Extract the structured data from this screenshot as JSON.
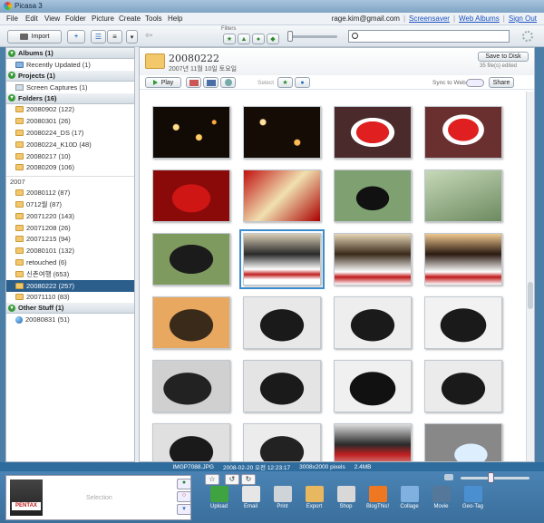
{
  "window": {
    "title": "Picasa 3"
  },
  "menu": {
    "items": [
      "File",
      "Edit",
      "View",
      "Folder",
      "Picture",
      "Create",
      "Tools",
      "Help"
    ],
    "email": "rage.kim@gmail.com",
    "screensaver": "Screensaver",
    "web_albums": "Web Albums",
    "sign_out": "Sign Out",
    "separator": "|"
  },
  "toolbar": {
    "import_label": "Import",
    "filters_label": "Filters",
    "search_value": ""
  },
  "sidebar": {
    "sections": [
      {
        "title": "Albums (1)",
        "items": [
          {
            "label": "Recently Updated (1)",
            "icon": "album-icon"
          }
        ]
      },
      {
        "title": "Projects (1)",
        "items": [
          {
            "label": "Screen Captures (1)",
            "icon": "screen-icon"
          }
        ]
      },
      {
        "title": "Folders (16)",
        "items": [
          {
            "label": "20080902 (122)"
          },
          {
            "label": "20080301 (26)"
          },
          {
            "label": "20080224_DS (17)"
          },
          {
            "label": "20080224_K10D (48)"
          },
          {
            "label": "20080217 (10)"
          },
          {
            "label": "20080209 (106)"
          }
        ]
      }
    ],
    "year": "2007",
    "year_items": [
      {
        "label": "20080112 (87)"
      },
      {
        "label": "0712월 (87)"
      },
      {
        "label": "20071220 (143)"
      },
      {
        "label": "20071208 (26)"
      },
      {
        "label": "20071215 (94)"
      },
      {
        "label": "20080101 (132)"
      },
      {
        "label": "retouched (6)"
      },
      {
        "label": "신촌여행 (653)"
      },
      {
        "label": "20080222 (257)",
        "selected": true
      },
      {
        "label": "20071110 (83)"
      }
    ],
    "other": {
      "title": "Other Stuff (1)",
      "items": [
        {
          "label": "20080831 (51)"
        }
      ]
    }
  },
  "folder": {
    "name": "20080222",
    "date": "2007년 11월 10일 토요일",
    "save_to_disk": "Save to Disk",
    "files_edited": "35 file(s) edited",
    "play": "Play",
    "select": "Select",
    "sync": "Sync to Web",
    "share": "Share"
  },
  "thumbnails": [
    {
      "bg": "radial-gradient(circle at 30% 40%,#ffdd88 0 3px,transparent 4px),radial-gradient(circle at 60% 60%,#ffcc66 0 3px,transparent 4px),radial-gradient(circle at 80% 30%,#ffaa44 0 2px,transparent 3px),#120a04"
    },
    {
      "bg": "radial-gradient(circle at 25% 30%,#ffe0a0 0 3px,transparent 4px),radial-gradient(circle at 70% 70%,#ffbb55 0 3px,transparent 4px),#150c05"
    },
    {
      "bg": "radial-gradient(ellipse at 50% 50%,#e02020 0 30%,#fff 31% 40%,#4a2a2a 41%)"
    },
    {
      "bg": "radial-gradient(ellipse at 50% 45%,#e02020 0 28%,#fff 29% 38%,#6a3030 39%)"
    },
    {
      "bg": "radial-gradient(ellipse at 50% 55%,#d01515 0 35%,#8a0a0a 36%)"
    },
    {
      "bg": "linear-gradient(135deg,#c01010,#f0e0b0 50%,#a00)"
    },
    {
      "bg": "radial-gradient(ellipse at 50% 55%,#111 0 30%,#7fa070 31%)"
    },
    {
      "bg": "linear-gradient(160deg,#c6d8b8,#6d8a60)"
    },
    {
      "bg": "radial-gradient(ellipse at 50% 50%,#1b1b1b 0 40%,#7f9a5f 41%)"
    },
    {
      "bg": "linear-gradient(#d8ccb5,#2a2a2a 40%,#fff 70%,#c02020 80%,#fff 90%)"
    },
    {
      "bg": "linear-gradient(#e6d5b5,#3a2a1a 40%,#fff 75%,#c01818 85%,#fff)"
    },
    {
      "bg": "linear-gradient(#f0c890,#2a1a10 40%,#fff 75%,#c01818 85%,#fff)"
    },
    {
      "bg": "radial-gradient(ellipse at 50% 55%,#3a2a1a 0 40%,#e8a860 41%)"
    },
    {
      "bg": "radial-gradient(ellipse at 50% 55%,#1a1a1a 0 40%,#e8e8e8 41%)"
    },
    {
      "bg": "radial-gradient(ellipse at 50% 55%,#1a1a1a 0 40%,#eeeeee 41%)"
    },
    {
      "bg": "radial-gradient(ellipse at 50% 55%,#1a1a1a 0 42%,#f2f2f2 43%)"
    },
    {
      "bg": "radial-gradient(ellipse at 45% 55%,#222 0 40%,#d0d0d0 41%)"
    },
    {
      "bg": "radial-gradient(ellipse at 50% 55%,#1a1a1a 0 40%,#e4e4e4 41%)"
    },
    {
      "bg": "radial-gradient(ellipse at 50% 55%,#111 0 42%,#f0f0f0 43%)"
    },
    {
      "bg": "radial-gradient(ellipse at 50% 55%,#1a1a1a 0 40%,#ebebeb 41%)"
    },
    {
      "bg": "radial-gradient(ellipse at 50% 55%,#1a1a1a 0 40%,#e0e0e0 41%)"
    },
    {
      "bg": "radial-gradient(ellipse at 50% 55%,#222 0 40%,#ececec 41%)"
    },
    {
      "bg": "linear-gradient(#ddd,#2a2a2a 40%,#c02020 60%,#eee)"
    },
    {
      "bg": "radial-gradient(ellipse at 60% 60%,#ddeeff 0 25%,#888 26%)"
    }
  ],
  "status": {
    "file": "IMGP7088.JPG",
    "datetime": "2008-02-20 오전 12:23:17",
    "dims": "3008x2000 pixels",
    "size": "2.4MB"
  },
  "tray": {
    "selection_label": "Selection",
    "thumb_label": "PENTAX",
    "actions": [
      {
        "label": "Upload",
        "color": "#3fa33f"
      },
      {
        "label": "Email",
        "color": "#e6e6e6"
      },
      {
        "label": "Print",
        "color": "#cfd4d9"
      },
      {
        "label": "Export",
        "color": "#e8b860"
      },
      {
        "label": "Shop",
        "color": "#d8d8d8"
      },
      {
        "label": "BlogThis!",
        "color": "#ee7722"
      },
      {
        "label": "Collage",
        "color": "#7fb0e0"
      },
      {
        "label": "Movie",
        "color": "#557799"
      },
      {
        "label": "Geo-Tag",
        "color": "#4a90d0"
      }
    ]
  }
}
